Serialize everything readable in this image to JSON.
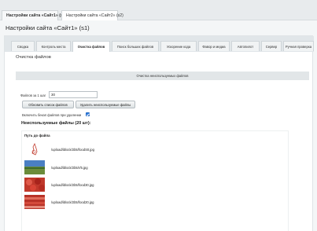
{
  "site_tabs": [
    {
      "label": "Настройки сайта «Сайт1» (s1)",
      "active": true
    },
    {
      "label": "Настройки сайта «Сайт2» (s2)",
      "active": false
    }
  ],
  "page_title": "Настройки сайта «Сайт1» (s1)",
  "tabs": [
    {
      "label": "Сводка"
    },
    {
      "label": "Контроль места"
    },
    {
      "label": "Очистка файлов",
      "active": true
    },
    {
      "label": "Поиск больших файлов"
    },
    {
      "label": "Ускорение кода"
    },
    {
      "label": "Фавор и медиа"
    },
    {
      "label": "Автопилот"
    },
    {
      "label": "Сервер"
    },
    {
      "label": "Ручная проверка"
    }
  ],
  "section_heading": "Очистка файлов",
  "banner": "Очистка неиспользуемых файлов",
  "form": {
    "files_per_step_label": "Файлов за 1 шаг",
    "files_per_step_value": "30",
    "update_button": "Обновить список файлов",
    "delete_button": "Удалить неиспользуемые файлы",
    "backup_label": "Включить бекап файлов при удалении",
    "backup_checked": true
  },
  "unused": {
    "heading": "Неиспользуемые файлы (20 шт):",
    "column_header": "Путь до файла",
    "files": [
      {
        "path": "/upload/iblock/2b5/foodS0.jpg",
        "thumb": "sketch"
      },
      {
        "path": "/upload/iblock/2b5/r/5.jpg",
        "thumb": "landscape"
      },
      {
        "path": "/upload/iblock/2b5/food30.jpg",
        "thumb": "red-food"
      },
      {
        "path": "/upload/iblock/2b5/food20.jpg",
        "thumb": "red-food-2"
      }
    ]
  }
}
